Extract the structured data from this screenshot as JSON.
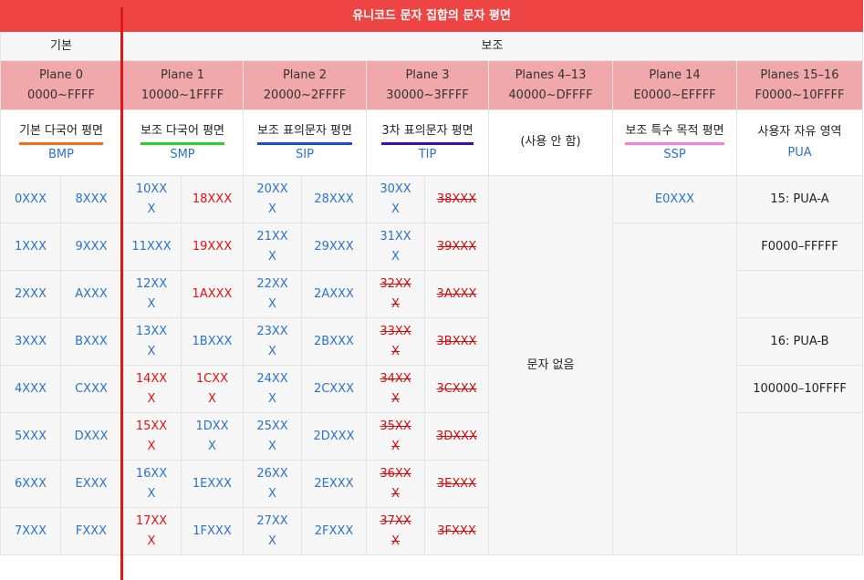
{
  "title": "유니코드 문자 집합의 문자 평면",
  "groups": {
    "basic": "기본",
    "supplementary": "보조"
  },
  "planes": [
    {
      "label": "Plane 0",
      "range": "0000~FFFF",
      "name": "기본 다국어 평면",
      "abbr": "BMP"
    },
    {
      "label": "Plane 1",
      "range": "10000~1FFFF",
      "name": "보조 다국어 평면",
      "abbr": "SMP"
    },
    {
      "label": "Plane 2",
      "range": "20000~2FFFF",
      "name": "보조 표의문자 평면",
      "abbr": "SIP"
    },
    {
      "label": "Plane 3",
      "range": "30000~3FFFF",
      "name": "3차 표의문자 평면",
      "abbr": "TIP"
    },
    {
      "label": "Planes 4–13",
      "range": "40000~DFFFF",
      "name": "(사용 안 함)",
      "abbr": ""
    },
    {
      "label": "Plane 14",
      "range": "E0000~EFFFF",
      "name": "보조 특수 목적 평면",
      "abbr": "SSP"
    },
    {
      "label": "Planes 15–16",
      "range": "F0000~10FFFF",
      "name": "사용자 자유 영역",
      "abbr": "PUA"
    }
  ],
  "plane0": [
    [
      "0XXX",
      "8XXX"
    ],
    [
      "1XXX",
      "9XXX"
    ],
    [
      "2XXX",
      "AXXX"
    ],
    [
      "3XXX",
      "BXXX"
    ],
    [
      "4XXX",
      "CXXX"
    ],
    [
      "5XXX",
      "DXXX"
    ],
    [
      "6XXX",
      "EXXX"
    ],
    [
      "7XXX",
      "FXXX"
    ]
  ],
  "plane1": [
    [
      "10XX\nX",
      "18XXX"
    ],
    [
      "11XXX",
      "19XXX"
    ],
    [
      "12XX\nX",
      "1AXXX"
    ],
    [
      "13XX\nX",
      "1BXXX"
    ],
    [
      "14XX\nX",
      "1CXX\nX"
    ],
    [
      "15XX\nX",
      "1DXX\nX"
    ],
    [
      "16XX\nX",
      "1EXXX"
    ],
    [
      "17XX\nX",
      "1FXXX"
    ]
  ],
  "plane1_colors": [
    [
      "b",
      "r"
    ],
    [
      "b",
      "r"
    ],
    [
      "b",
      "r"
    ],
    [
      "b",
      "b"
    ],
    [
      "r",
      "r"
    ],
    [
      "r",
      "b"
    ],
    [
      "b",
      "b"
    ],
    [
      "r",
      "b"
    ]
  ],
  "plane2": [
    [
      "20XX\nX",
      "28XXX"
    ],
    [
      "21XX\nX",
      "29XXX"
    ],
    [
      "22XX\nX",
      "2AXXX"
    ],
    [
      "23XX\nX",
      "2BXXX"
    ],
    [
      "24XX\nX",
      "2CXXX"
    ],
    [
      "25XX\nX",
      "2DXXX"
    ],
    [
      "26XX\nX",
      "2EXXX"
    ],
    [
      "27XX\nX",
      "2FXXX"
    ]
  ],
  "plane3": [
    [
      "30XX\nX",
      "38XXX"
    ],
    [
      "31XX\nX",
      "39XXX"
    ],
    [
      "32XX\nX",
      "3AXXX"
    ],
    [
      "33XX\nX",
      "3BXXX"
    ],
    [
      "34XX\nX",
      "3CXXX"
    ],
    [
      "35XX\nX",
      "3DXXX"
    ],
    [
      "36XX\nX",
      "3EXXX"
    ],
    [
      "37XX\nX",
      "3FXXX"
    ]
  ],
  "plane3_colors": [
    [
      "b",
      "x"
    ],
    [
      "b",
      "x"
    ],
    [
      "x",
      "x"
    ],
    [
      "x",
      "x"
    ],
    [
      "x",
      "x"
    ],
    [
      "x",
      "x"
    ],
    [
      "x",
      "x"
    ],
    [
      "x",
      "x"
    ]
  ],
  "planes4_13_body": "문자 없음",
  "plane14_body": "E0XXX",
  "pua": [
    "15: PUA-A",
    "F0000–FFFFF",
    "",
    "16: PUA-B",
    "100000–10FFFF"
  ],
  "colors": {
    "title_bg": "#ee4444",
    "plane_bg": "#f0a8aa",
    "blue": "#2a73c8",
    "red": "#e81010"
  }
}
